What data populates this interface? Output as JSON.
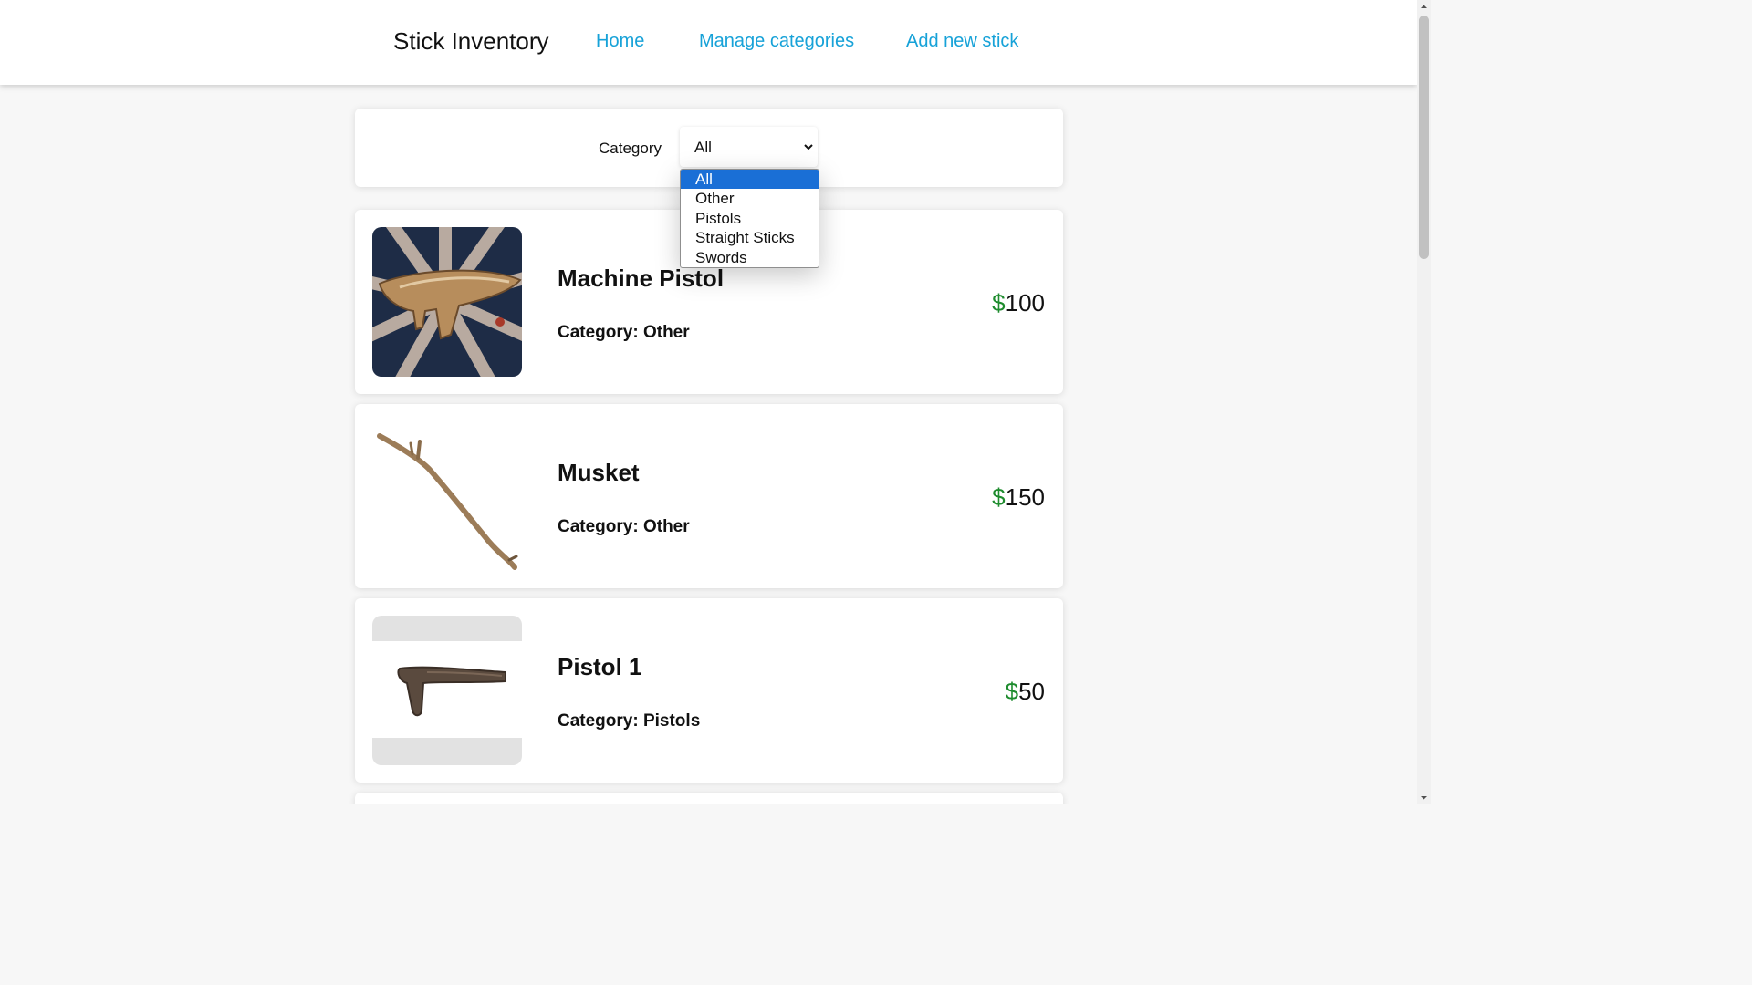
{
  "header": {
    "brand": "Stick Inventory",
    "nav": {
      "home": "Home",
      "manage_categories": "Manage categories",
      "add_new_stick": "Add new stick"
    }
  },
  "filter": {
    "label": "Category",
    "selected": "All",
    "options": [
      "All",
      "Other",
      "Pistols",
      "Straight Sticks",
      "Swords"
    ]
  },
  "currency_symbol": "$",
  "items": [
    {
      "name": "Machine Pistol",
      "category_text": "Category: Other",
      "price": "100"
    },
    {
      "name": "Musket",
      "category_text": "Category: Other",
      "price": "150"
    },
    {
      "name": "Pistol 1",
      "category_text": "Category: Pistols",
      "price": "50"
    }
  ],
  "colors": {
    "nav_link": "#17a2d8",
    "dollar_sign": "#1e8c2e",
    "selected_option": "#1a6fd6"
  }
}
